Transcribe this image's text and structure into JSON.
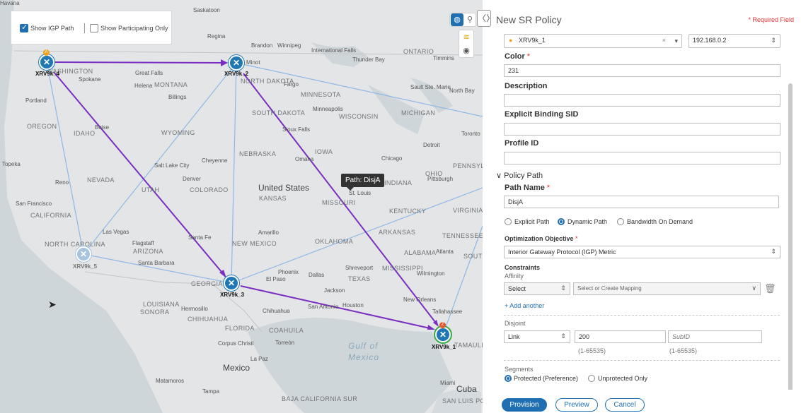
{
  "map": {
    "show_igp_path_label": "Show IGP Path",
    "show_participating_label": "Show Participating Only",
    "path_tooltip": "Path: DisjA",
    "country_label": "United States",
    "country_label_2": "Mexico",
    "country_label_3": "Cuba",
    "gulf_label_1": "Gulf of",
    "gulf_label_2": "Mexico",
    "region_labels": [
      "Saskatoon",
      "Regina",
      "Brandon",
      "Winnipeg",
      "International Falls",
      "Thunder Bay",
      "ONTARIO",
      "Timmins",
      "Sault Ste. Marie",
      "North Bay",
      "Minot",
      "MONTANA",
      "Great Falls",
      "Helena",
      "Billings",
      "Spokane",
      "WASHINGTON",
      "Portland",
      "OREGON",
      "IDAHO",
      "Boise",
      "WYOMING",
      "NORTH DAKOTA",
      "Fargo",
      "MINNESOTA",
      "Minneapolis",
      "SOUTH DAKOTA",
      "Sioux Falls",
      "WISCONSIN",
      "MICHIGAN",
      "Toronto",
      "Detroit",
      "NEBRASKA",
      "IOWA",
      "Chicago",
      "Omaha",
      "Cheyenne",
      "Salt Lake City",
      "NEVADA",
      "UTAH",
      "Denver",
      "COLORADO",
      "KANSAS",
      "MISSOURI",
      "St. Louis",
      "INDIANA",
      "OHIO",
      "Pittsburgh",
      "PENNSYLVANIA",
      "Reno",
      "Topeka",
      "San Francisco",
      "CALIFORNIA",
      "Las Vegas",
      "KENTUCKY",
      "VIRGINIA",
      "ARIZONA",
      "Flagstaff",
      "Santa Fe",
      "NEW MEXICO",
      "Amarillo",
      "OKLAHOMA",
      "ARKANSAS",
      "TENNESSEE",
      "NORTH CAROLINA",
      "Santa Barbara",
      "Phoenix",
      "Dallas",
      "Shreveport",
      "MISSISSIPPI",
      "ALABAMA",
      "Atlanta",
      "SOUTH CAROLINA",
      "Wilmington",
      "GEORGIA",
      "El Paso",
      "TEXAS",
      "Jackson",
      "LOUISIANA",
      "SONORA",
      "Hermosillo",
      "CHIHUAHUA",
      "Chihuahua",
      "San Antonio",
      "Houston",
      "New Orleans",
      "Tallahassee",
      "FLORIDA",
      "COAHUILA",
      "Corpus Christi",
      "Torreón",
      "Matamoros",
      "La Paz",
      "TAMAULIPAS",
      "Miami",
      "Tampa",
      "BAJA CALIFORNIA SUR",
      "SAN LUIS POTOSÍ",
      "Havana"
    ],
    "nodes": [
      {
        "id": "XRV9k_4",
        "label": "XRV9k_4"
      },
      {
        "id": "XRV9k_2",
        "label": "XRV9k_2"
      },
      {
        "id": "XRV9k_5",
        "label": "XRV9k_5"
      },
      {
        "id": "XRV9k_3",
        "label": "XRV9k_3"
      },
      {
        "id": "XRV9k_1",
        "label": "XRV9k_1"
      }
    ],
    "badge_a": "A",
    "badge_z": "Z",
    "colors": {
      "active_path": "#7a2fc2",
      "link": "#8fb8e6",
      "node": "#1f77b4",
      "node_selected_ring": "#3aa845"
    }
  },
  "panel": {
    "title": "New SR Policy",
    "required_note": "* Required Field",
    "headend_value": "XRV9k_1",
    "headend_clear": "×",
    "headend_ip": "192.168.0.2",
    "color_label": "Color",
    "color_value": "231",
    "description_label": "Description",
    "description_value": "",
    "binding_sid_label": "Explicit Binding SID",
    "binding_sid_value": "",
    "profile_id_label": "Profile ID",
    "profile_id_value": "",
    "policy_path_label": "Policy Path",
    "path_name_label": "Path Name",
    "path_name_value": "DisjA",
    "path_types": [
      "Explicit Path",
      "Dynamic Path",
      "Bandwidth On Demand"
    ],
    "path_type_selected": "Dynamic Path",
    "opt_objective_label": "Optimization Objective",
    "opt_objective_value": "Interior Gateway Protocol (IGP) Metric",
    "constraints_label": "Constraints",
    "affinity_label": "Affinity",
    "affinity_select": "Select",
    "affinity_mapping_placeholder": "Select or Create Mapping",
    "add_another": "+ Add another",
    "disjoint_label": "Disjoint",
    "disjoint_type": "Link",
    "disjoint_group": "200",
    "disjoint_subid_placeholder": "SubID",
    "disjoint_group_hint": "(1-65535)",
    "disjoint_subid_hint": "(1-65535)",
    "segments_label": "Segments",
    "segment_options": [
      "Protected (Preference)",
      "Unprotected Only"
    ],
    "segment_selected": "Protected (Preference)",
    "required_mark": "*"
  },
  "footer": {
    "provision": "Provision",
    "preview": "Preview",
    "cancel": "Cancel"
  }
}
